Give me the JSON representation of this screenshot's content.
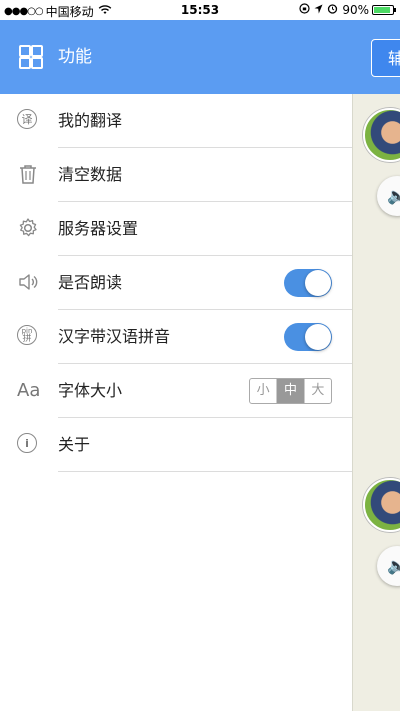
{
  "status_bar": {
    "signal": "●●●○○",
    "carrier": "中国移动",
    "time": "15:53",
    "battery_percent": "90%",
    "battery_level": 0.9
  },
  "header": {
    "title": "功能",
    "right_button_label": "辅"
  },
  "menu": {
    "items": [
      {
        "label": "我的翻译",
        "icon": "translate-icon",
        "icon_glyph": "译"
      },
      {
        "label": "清空数据",
        "icon": "trash-icon"
      },
      {
        "label": "服务器设置",
        "icon": "gear-icon"
      },
      {
        "label": "是否朗读",
        "icon": "speaker-icon",
        "toggle_on": true
      },
      {
        "label": "汉字带汉语拼音",
        "icon": "pinyin-icon",
        "icon_glyph": "pin拼",
        "toggle_on": true
      },
      {
        "label": "字体大小",
        "icon": "font-size-icon",
        "icon_glyph": "Aa",
        "options": [
          "小",
          "中",
          "大"
        ],
        "selected": "中"
      },
      {
        "label": "关于",
        "icon": "info-icon",
        "icon_glyph": "i"
      }
    ]
  },
  "colors": {
    "header": "#5b9cf2",
    "toggle_on": "#4a90e2",
    "battery": "#4cd964"
  }
}
